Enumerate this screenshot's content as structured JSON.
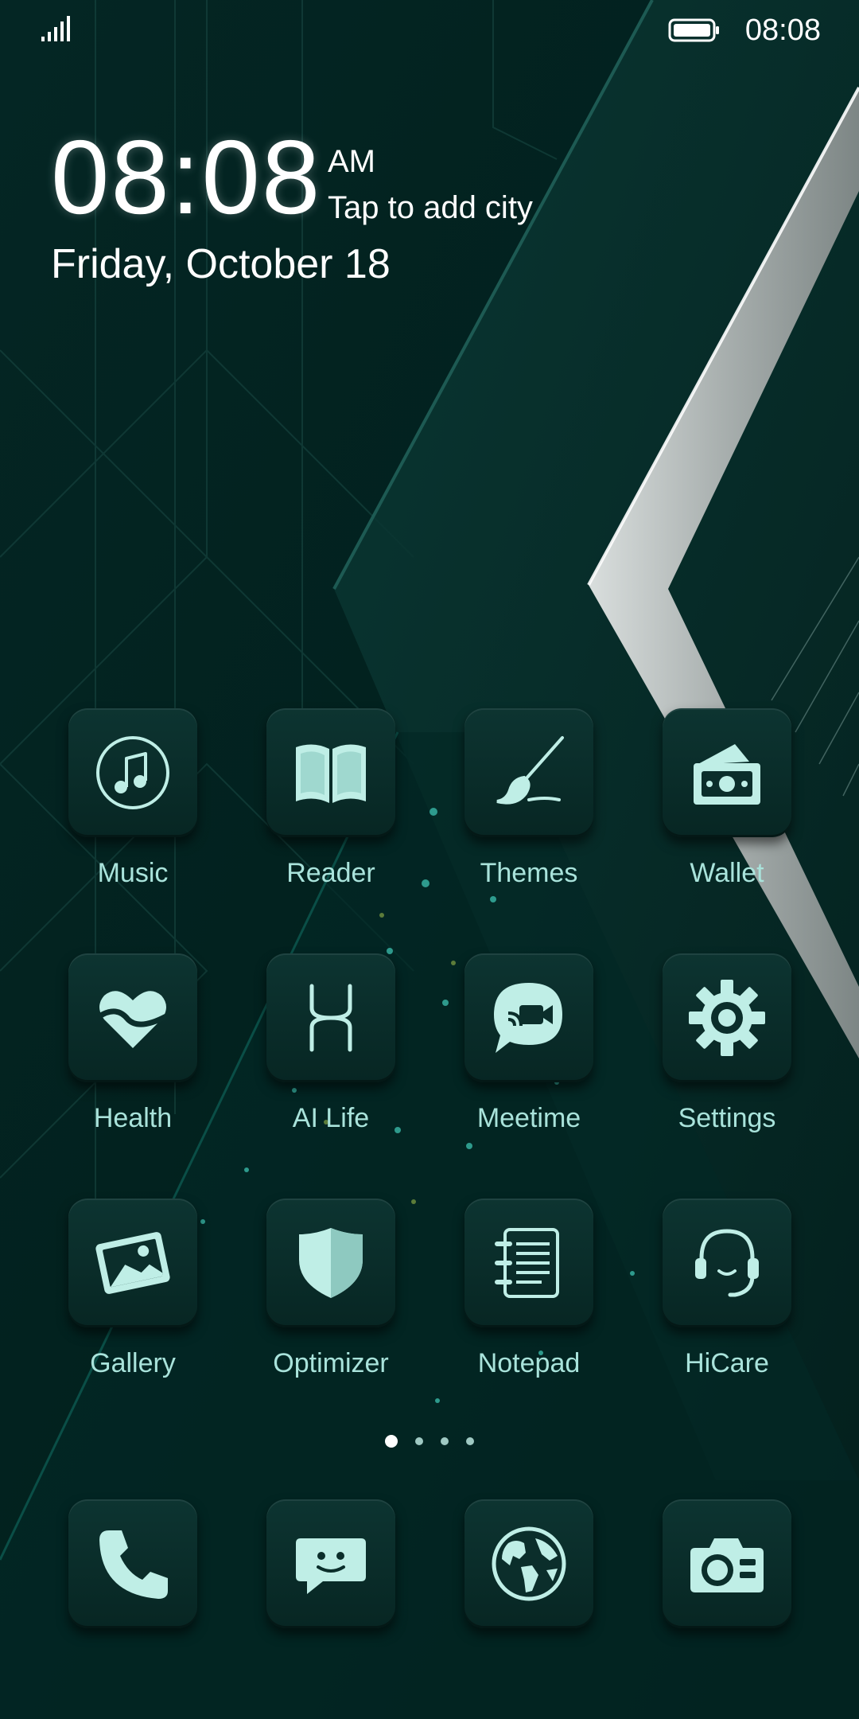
{
  "status_bar": {
    "time": "08:08",
    "signal_icon": "signal-icon",
    "battery_icon": "battery-icon"
  },
  "lock_clock": {
    "time": "08:08",
    "ampm": "AM",
    "city_prompt": "Tap to add city",
    "date": "Friday, October 18"
  },
  "apps": [
    {
      "label": "Music",
      "icon": "music-note-icon"
    },
    {
      "label": "Reader",
      "icon": "book-icon"
    },
    {
      "label": "Themes",
      "icon": "paintbrush-icon"
    },
    {
      "label": "Wallet",
      "icon": "wallet-icon"
    },
    {
      "label": "Health",
      "icon": "heart-icon"
    },
    {
      "label": "AI Life",
      "icon": "ai-life-icon"
    },
    {
      "label": "Meetime",
      "icon": "video-chat-icon"
    },
    {
      "label": "Settings",
      "icon": "gear-icon"
    },
    {
      "label": "Gallery",
      "icon": "photo-icon"
    },
    {
      "label": "Optimizer",
      "icon": "shield-icon"
    },
    {
      "label": "Notepad",
      "icon": "notepad-icon"
    },
    {
      "label": "HiCare",
      "icon": "headset-icon"
    }
  ],
  "page_indicator": {
    "count": 4,
    "active_index": 0
  },
  "dock": [
    {
      "icon": "phone-icon"
    },
    {
      "icon": "messages-icon"
    },
    {
      "icon": "browser-globe-icon"
    },
    {
      "icon": "camera-icon"
    }
  ],
  "colors": {
    "background": "#04201d",
    "label": "#a9e3db",
    "icon": "#bfeee6",
    "tile": "#0b2e2b"
  }
}
